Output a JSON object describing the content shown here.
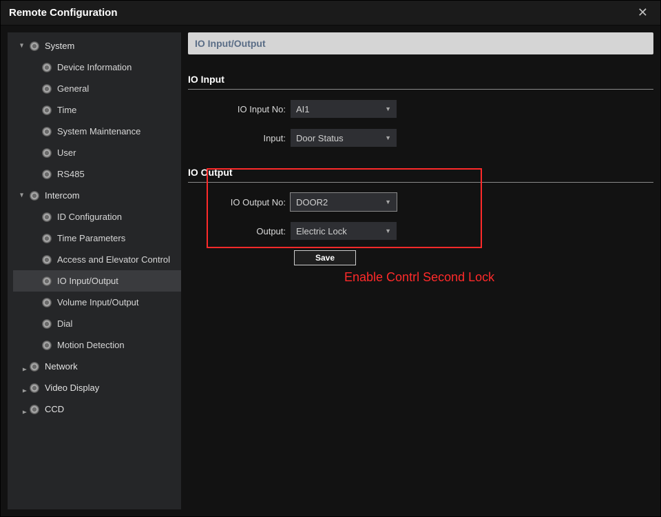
{
  "window": {
    "title": "Remote Configuration"
  },
  "sidebar": {
    "groups": [
      {
        "label": "System",
        "expanded": true,
        "items": [
          "Device Information",
          "General",
          "Time",
          "System Maintenance",
          "User",
          "RS485"
        ]
      },
      {
        "label": "Intercom",
        "expanded": true,
        "active_index": 3,
        "items": [
          "ID Configuration",
          "Time Parameters",
          "Access and Elevator Control",
          "IO Input/Output",
          "Volume Input/Output",
          "Dial",
          "Motion Detection"
        ]
      },
      {
        "label": "Network",
        "expanded": false
      },
      {
        "label": "Video Display",
        "expanded": false
      },
      {
        "label": "CCD",
        "expanded": false
      }
    ]
  },
  "main": {
    "page_header": "IO Input/Output",
    "input_section": {
      "title": "IO Input",
      "rows": [
        {
          "label": "IO Input No:",
          "value": "AI1"
        },
        {
          "label": "Input:",
          "value": "Door Status"
        }
      ]
    },
    "output_section": {
      "title": "IO Output",
      "rows": [
        {
          "label": "IO Output No:",
          "value": "DOOR2",
          "outlined": true
        },
        {
          "label": "Output:",
          "value": "Electric Lock",
          "outlined": false
        }
      ],
      "save_label": "Save"
    }
  },
  "annotation": {
    "text": "Enable Contrl Second Lock"
  }
}
